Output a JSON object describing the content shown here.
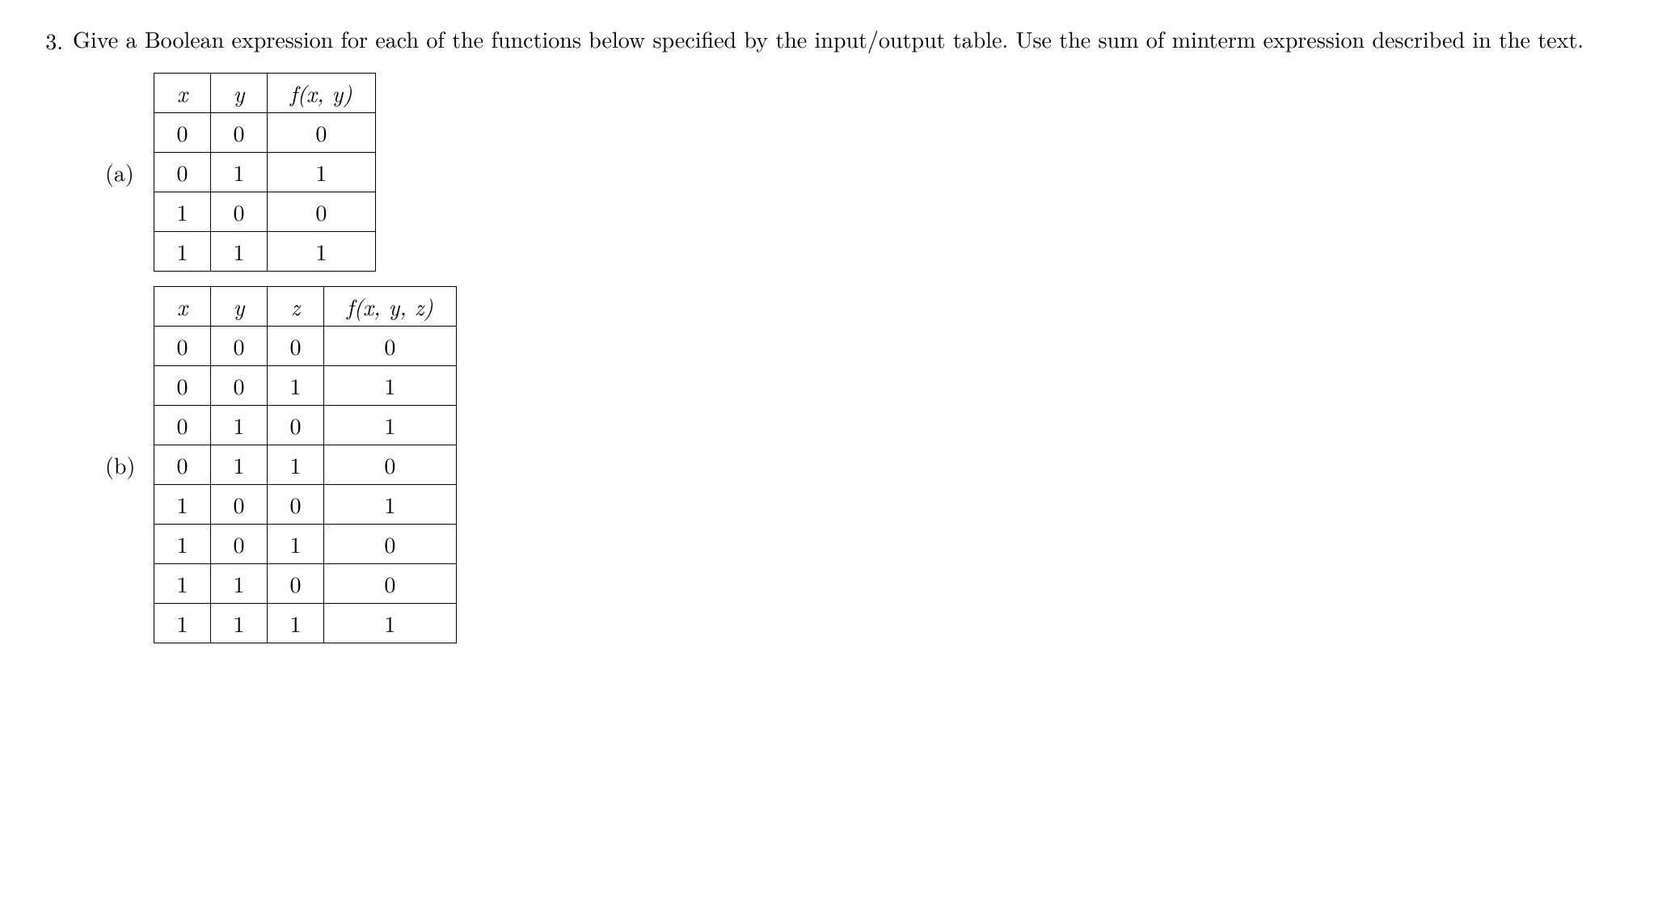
{
  "question": {
    "number": "3.",
    "text": "Give a Boolean expression for each of the functions below specified by the input/output table. Use the sum of minterm expression described in the text."
  },
  "partA": {
    "label": "(a)",
    "headers": {
      "x": "x",
      "y": "y",
      "f": "f(x, y)"
    },
    "rows": [
      {
        "x": "0",
        "y": "0",
        "f": "0"
      },
      {
        "x": "0",
        "y": "1",
        "f": "1"
      },
      {
        "x": "1",
        "y": "0",
        "f": "0"
      },
      {
        "x": "1",
        "y": "1",
        "f": "1"
      }
    ]
  },
  "partB": {
    "label": "(b)",
    "headers": {
      "x": "x",
      "y": "y",
      "z": "z",
      "f": "f(x, y, z)"
    },
    "rows": [
      {
        "x": "0",
        "y": "0",
        "z": "0",
        "f": "0"
      },
      {
        "x": "0",
        "y": "0",
        "z": "1",
        "f": "1"
      },
      {
        "x": "0",
        "y": "1",
        "z": "0",
        "f": "1"
      },
      {
        "x": "0",
        "y": "1",
        "z": "1",
        "f": "0"
      },
      {
        "x": "1",
        "y": "0",
        "z": "0",
        "f": "1"
      },
      {
        "x": "1",
        "y": "0",
        "z": "1",
        "f": "0"
      },
      {
        "x": "1",
        "y": "1",
        "z": "0",
        "f": "0"
      },
      {
        "x": "1",
        "y": "1",
        "z": "1",
        "f": "1"
      }
    ]
  }
}
